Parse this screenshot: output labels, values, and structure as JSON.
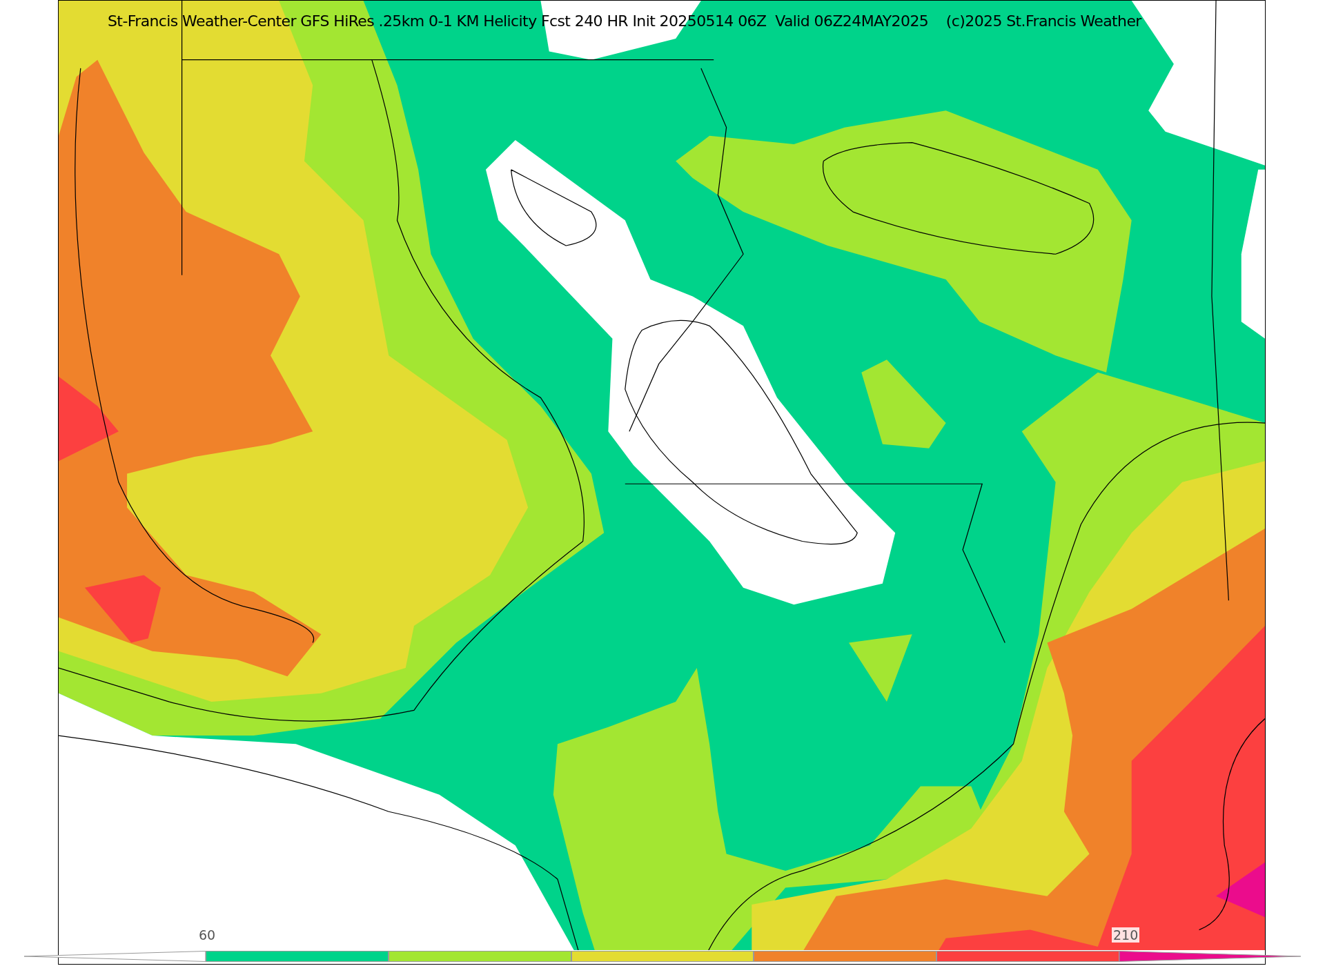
{
  "title": "St-Francis Weather-Center GFS HiRes .25km 0-1 KM Helicity Fcst 240 HR Init 20250514 06Z  Valid 06Z24MAY2025    (c)2025 St.Francis Weather",
  "colorbar": {
    "segments": [
      {
        "color": "#00d38a"
      },
      {
        "color": "#a3e632"
      },
      {
        "color": "#e3dc32"
      },
      {
        "color": "#f0822a"
      },
      {
        "color": "#fc4040"
      },
      {
        "color": "#eb0c8c"
      }
    ],
    "tick_labels": [
      "60",
      "210"
    ]
  }
}
